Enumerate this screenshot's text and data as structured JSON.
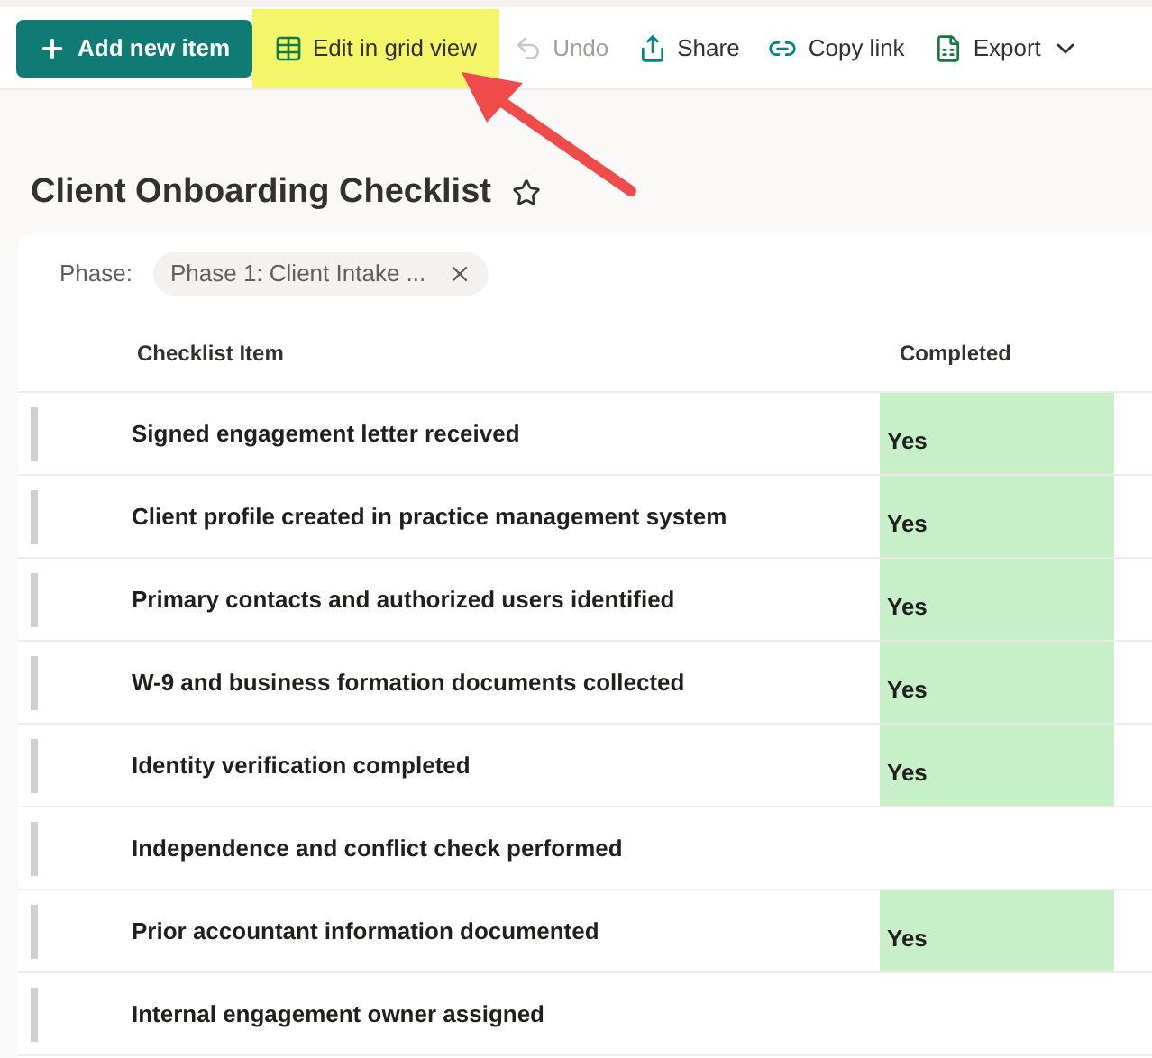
{
  "toolbar": {
    "buttons": [
      {
        "kind": "primary",
        "label": "Add new item",
        "disabled": false,
        "highlighted": false
      },
      {
        "kind": "grid",
        "label": "Edit in grid view",
        "disabled": false,
        "highlighted": true
      },
      {
        "kind": "undo",
        "label": "Undo",
        "disabled": true,
        "highlighted": false
      },
      {
        "kind": "share",
        "label": "Share",
        "disabled": false,
        "highlighted": false
      },
      {
        "kind": "link",
        "label": "Copy link",
        "disabled": false,
        "highlighted": false
      },
      {
        "kind": "export",
        "label": "Export",
        "disabled": false,
        "highlighted": false
      }
    ]
  },
  "title": "Client Onboarding Checklist",
  "filter": {
    "label": "Phase:",
    "value": "Phase 1: Client Intake ..."
  },
  "table": {
    "columns": [
      "Checklist Item",
      "Completed"
    ],
    "rows": [
      {
        "item": "Signed engagement letter received",
        "completed": "Yes"
      },
      {
        "item": "Client profile created in practice management system",
        "completed": "Yes"
      },
      {
        "item": "Primary contacts and authorized users identified",
        "completed": "Yes"
      },
      {
        "item": "W-9 and business formation documents collected",
        "completed": "Yes"
      },
      {
        "item": "Identity verification completed",
        "completed": "Yes"
      },
      {
        "item": "Independence and conflict check performed"
      },
      {
        "item": "Prior accountant information documented",
        "completed": "Yes"
      },
      {
        "item": "Internal engagement owner assigned"
      }
    ]
  }
}
